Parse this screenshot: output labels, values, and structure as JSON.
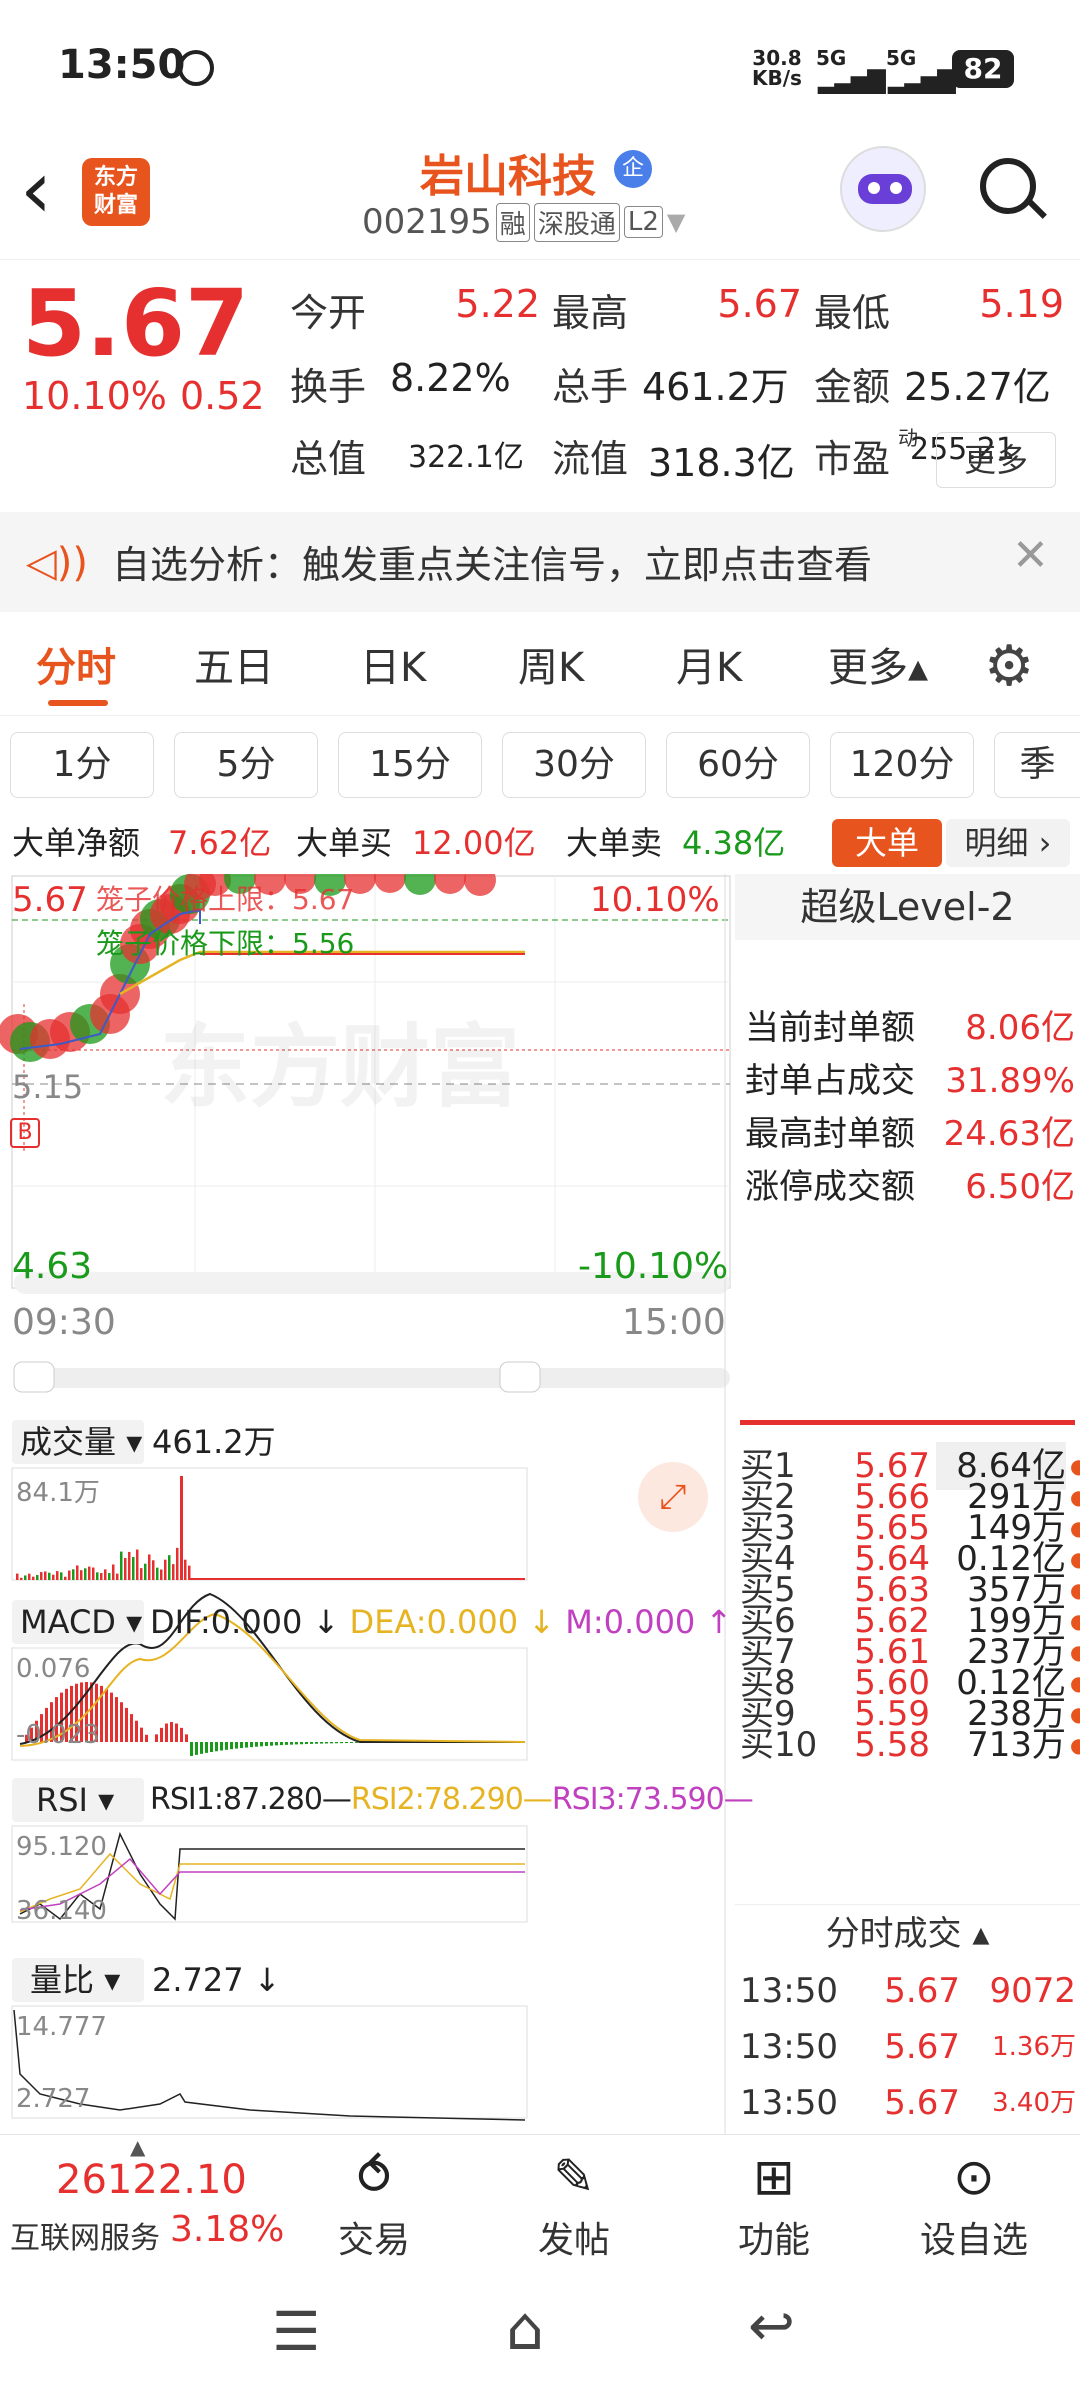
{
  "status": {
    "time": "13:50",
    "speed_top": "30.8",
    "speed_bot": "KB/s",
    "net1": "5G",
    "net2": "5G",
    "battery": "82"
  },
  "header": {
    "back_label": "‹",
    "logo_line1": "东方",
    "logo_line2": "财富",
    "title": "岩山科技",
    "title_badge": "企",
    "code": "002195",
    "tag1": "融",
    "tag2": "深股通",
    "tag3": "L2"
  },
  "quote": {
    "price": "5.67",
    "pct": "10.10%",
    "chg": "0.52",
    "fields": [
      {
        "label": "今开",
        "value": "5.22"
      },
      {
        "label": "最高",
        "value": "5.67"
      },
      {
        "label": "最低",
        "value": "5.19"
      },
      {
        "label": "换手",
        "value": "8.22%"
      },
      {
        "label": "总手",
        "value": "461.2万"
      },
      {
        "label": "金额",
        "value": "25.27亿"
      },
      {
        "label": "总值",
        "value": "322.1亿"
      },
      {
        "label": "流值",
        "value": "318.3亿"
      },
      {
        "label": "市盈",
        "value": "255.21",
        "sup": "动"
      }
    ],
    "more_label": "更多"
  },
  "banner": {
    "text": "自选分析：触发重点关注信号，立即点击查看"
  },
  "tabs": [
    "分时",
    "五日",
    "日K",
    "周K",
    "月K",
    "更多▴"
  ],
  "periods": [
    "1分",
    "5分",
    "15分",
    "30分",
    "60分",
    "120分",
    "季"
  ],
  "bigorder": {
    "net_label": "大单净额",
    "net_value": "7.62亿",
    "buy_label": "大单买",
    "buy_value": "12.00亿",
    "sell_label": "大单卖",
    "sell_value": "4.38亿",
    "btn1": "大单",
    "btn2": "明细 ›"
  },
  "chart": {
    "top_price": "5.67",
    "top_pct": "10.10%",
    "upper_limit": "笼子价格上限：5.67",
    "lower_limit": "笼子价格下限：5.56",
    "mid_price": "5.15",
    "low_price": "4.63",
    "low_pct": "-10.10%",
    "t_start": "09:30",
    "t_end": "15:00",
    "marker": "B",
    "watermark": "东方财富",
    "vol_label": "成交量",
    "vol_value": "461.2万",
    "vol_max": "84.1万",
    "macd_label": "MACD",
    "macd_dif": "DIF:0.000 ↓",
    "macd_dea": "DEA:0.000 ↓",
    "macd_m": "M:0.000 ↑",
    "macd_top": "0.076",
    "macd_bot": "-0.023",
    "rsi_label": "RSI",
    "rsi1": "RSI1:87.280—",
    "rsi2": "RSI2:78.290—",
    "rsi3": "RSI3:73.590—",
    "rsi_top": "95.120",
    "rsi_bot": "36.140",
    "lb_label": "量比",
    "lb_value": "2.727 ↓",
    "lb_top": "14.777",
    "lb_bot": "2.727",
    "colors": {
      "red": "#e5302f",
      "green": "#1a9a1a",
      "yellow": "#e6b422",
      "purple": "#c040c0",
      "line": "#3c5ac8"
    }
  },
  "level2": {
    "title": "超级Level-2",
    "stats": [
      {
        "label": "当前封单额",
        "value": "8.06亿"
      },
      {
        "label": "封单占成交",
        "value": "31.89%"
      },
      {
        "label": "最高封单额",
        "value": "24.63亿"
      },
      {
        "label": "涨停成交额",
        "value": "6.50亿"
      }
    ],
    "bids": [
      {
        "l": "买1",
        "p": "5.67",
        "v": "8.64亿"
      },
      {
        "l": "买2",
        "p": "5.66",
        "v": "291万"
      },
      {
        "l": "买3",
        "p": "5.65",
        "v": "149万"
      },
      {
        "l": "买4",
        "p": "5.64",
        "v": "0.12亿"
      },
      {
        "l": "买5",
        "p": "5.63",
        "v": "357万"
      },
      {
        "l": "买6",
        "p": "5.62",
        "v": "199万"
      },
      {
        "l": "买7",
        "p": "5.61",
        "v": "237万"
      },
      {
        "l": "买8",
        "p": "5.60",
        "v": "0.12亿"
      },
      {
        "l": "买9",
        "p": "5.59",
        "v": "238万"
      },
      {
        "l": "买10",
        "p": "5.58",
        "v": "713万"
      }
    ],
    "trades_title": "分时成交 ▴",
    "trades": [
      {
        "t": "13:50",
        "p": "5.67",
        "v": "9072"
      },
      {
        "t": "13:50",
        "p": "5.67",
        "v": "1.36万"
      },
      {
        "t": "13:50",
        "p": "5.67",
        "v": "3.40万"
      }
    ]
  },
  "bottom": {
    "index_value": "26122.10",
    "index_name": "互联网服务",
    "index_pct": "3.18%",
    "btn_trade": "交易",
    "btn_post": "发帖",
    "btn_func": "功能",
    "btn_watch": "设自选"
  }
}
